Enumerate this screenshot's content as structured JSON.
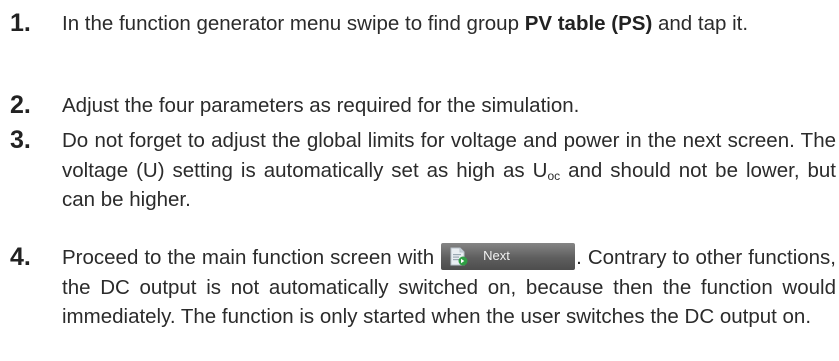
{
  "steps": [
    {
      "number": "1.",
      "text_before": "In the function generator menu swipe to find group ",
      "bold": "PV table (PS)",
      "text_after": " and tap it."
    },
    {
      "number": "2.",
      "text": "Adjust the four parameters as required for the simulation."
    },
    {
      "number": "3.",
      "text_before": "Do not forget to adjust the global limits for voltage and power in the next screen. The voltage (U) setting is automatically set as high as U",
      "subscript": "oc",
      "text_after": " and should not be lower, but can be higher."
    },
    {
      "number": "4.",
      "text_before": "Proceed to the main function screen with ",
      "button_label": "Next",
      "button_icon": "document-next-icon",
      "text_after": ". Contrary to other functions, the DC output is not automatically switched on, because then the function would immediately. The function is only started when the user switches the DC output on."
    }
  ]
}
